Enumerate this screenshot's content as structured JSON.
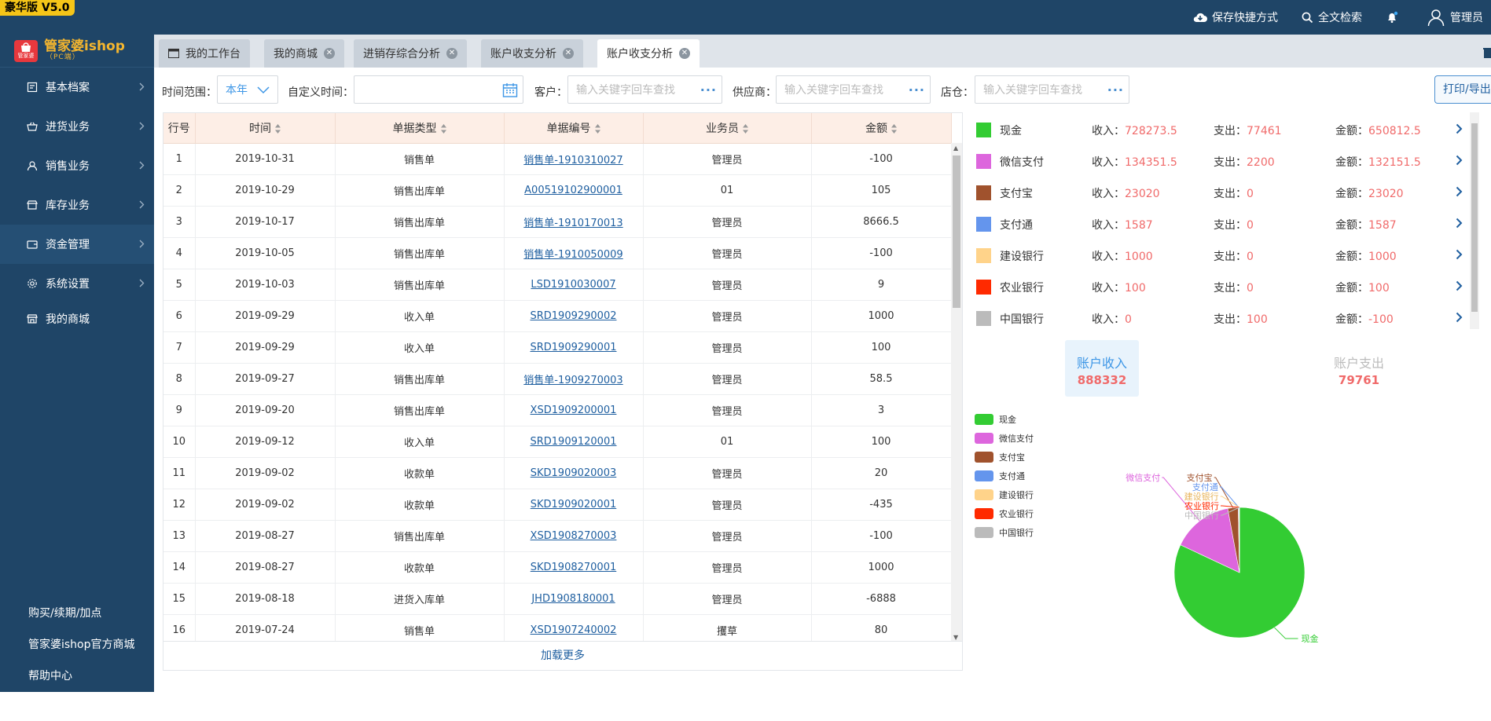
{
  "version": "豪华版 V5.0",
  "top_actions": {
    "save_shortcut": "保存快捷方式",
    "search": "全文检索",
    "user": "管理员"
  },
  "logo": {
    "badge": "管家婆",
    "title": "管家婆ishop",
    "subtitle": "（PC端）"
  },
  "sidebar": {
    "items": [
      {
        "label": "基本档案"
      },
      {
        "label": "进货业务"
      },
      {
        "label": "销售业务"
      },
      {
        "label": "库存业务"
      },
      {
        "label": "资金管理"
      },
      {
        "label": "系统设置"
      },
      {
        "label": "我的商城"
      }
    ],
    "bottom": [
      {
        "label": "购买/续期/加点"
      },
      {
        "label": "管家婆ishop官方商城"
      },
      {
        "label": "帮助中心"
      }
    ]
  },
  "tabs": [
    {
      "label": "我的工作台"
    },
    {
      "label": "我的商城"
    },
    {
      "label": "进销存综合分析"
    },
    {
      "label": "账户收支分析"
    },
    {
      "label": "账户收支分析"
    }
  ],
  "filters": {
    "time_range_label": "时间范围：",
    "time_range_value": "本年",
    "custom_time_label": "自定义时间：",
    "customer_label": "客户：",
    "customer_placeholder": "输入关键字回车查找",
    "supplier_label": "供应商：",
    "supplier_placeholder": "输入关键字回车查找",
    "store_label": "店仓：",
    "store_placeholder": "输入关键字回车查找",
    "print_label": "打印/导出"
  },
  "table": {
    "headers": [
      "行号",
      "时间",
      "单据类型",
      "单据编号",
      "业务员",
      "金额"
    ],
    "rows": [
      [
        "1",
        "2019-10-31",
        "销售单",
        "销售单-1910310027",
        "管理员",
        "-100"
      ],
      [
        "2",
        "2019-10-29",
        "销售出库单",
        "A00519102900001",
        "01",
        "105"
      ],
      [
        "3",
        "2019-10-17",
        "销售出库单",
        "销售单-1910170013",
        "管理员",
        "8666.5"
      ],
      [
        "4",
        "2019-10-05",
        "销售出库单",
        "销售单-1910050009",
        "管理员",
        "-100"
      ],
      [
        "5",
        "2019-10-03",
        "销售出库单",
        "LSD1910030007",
        "管理员",
        "9"
      ],
      [
        "6",
        "2019-09-29",
        "收入单",
        "SRD1909290002",
        "管理员",
        "1000"
      ],
      [
        "7",
        "2019-09-29",
        "收入单",
        "SRD1909290001",
        "管理员",
        "100"
      ],
      [
        "8",
        "2019-09-27",
        "销售出库单",
        "销售单-1909270003",
        "管理员",
        "58.5"
      ],
      [
        "9",
        "2019-09-20",
        "销售出库单",
        "XSD1909200001",
        "管理员",
        "3"
      ],
      [
        "10",
        "2019-09-12",
        "收入单",
        "SRD1909120001",
        "01",
        "100"
      ],
      [
        "11",
        "2019-09-02",
        "收款单",
        "SKD1909020003",
        "管理员",
        "20"
      ],
      [
        "12",
        "2019-09-02",
        "收款单",
        "SKD1909020001",
        "管理员",
        "-435"
      ],
      [
        "13",
        "2019-08-27",
        "销售出库单",
        "XSD1908270003",
        "管理员",
        "-100"
      ],
      [
        "14",
        "2019-08-27",
        "收款单",
        "SKD1908270001",
        "管理员",
        "1000"
      ],
      [
        "15",
        "2019-08-18",
        "进货入库单",
        "JHD1908180001",
        "管理员",
        "-6888"
      ],
      [
        "16",
        "2019-07-24",
        "销售单",
        "XSD1907240002",
        "攫草",
        "80"
      ]
    ],
    "load_more": "加载更多"
  },
  "accounts": {
    "income_label": "收入：",
    "expense_label": "支出：",
    "balance_label": "金额：",
    "items": [
      {
        "name": "现金",
        "color": "#33cc33",
        "income": "728273.5",
        "expense": "77461",
        "balance": "650812.5"
      },
      {
        "name": "微信支付",
        "color": "#dd66dd",
        "income": "134351.5",
        "expense": "2200",
        "balance": "132151.5"
      },
      {
        "name": "支付宝",
        "color": "#a0522d",
        "income": "23020",
        "expense": "0",
        "balance": "23020"
      },
      {
        "name": "支付通",
        "color": "#6495ed",
        "income": "1587",
        "expense": "0",
        "balance": "1587"
      },
      {
        "name": "建设银行",
        "color": "#ffd38a",
        "income": "1000",
        "expense": "0",
        "balance": "1000"
      },
      {
        "name": "农业银行",
        "color": "#ff2a00",
        "income": "100",
        "expense": "0",
        "balance": "100"
      },
      {
        "name": "中国银行",
        "color": "#bbbbbb",
        "income": "0",
        "expense": "100",
        "balance": "-100"
      }
    ]
  },
  "summary": {
    "income_title": "账户收入",
    "income_value": "888332",
    "expense_title": "账户支出",
    "expense_value": "79761"
  },
  "chart_data": {
    "type": "pie",
    "labels": [
      "现金",
      "微信支付",
      "支付宝",
      "支付通",
      "建设银行",
      "农业银行",
      "中国银行"
    ],
    "values": [
      728273.5,
      134351.5,
      23020,
      1587,
      1000,
      100,
      0
    ],
    "colors": [
      "#33cc33",
      "#dd66dd",
      "#a0522d",
      "#6495ed",
      "#ffd38a",
      "#ff2a00",
      "#bbbbbb"
    ],
    "legend": "left"
  }
}
